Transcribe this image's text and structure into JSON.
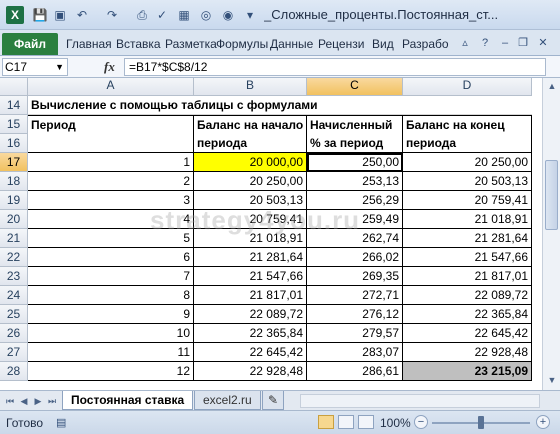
{
  "window": {
    "app_icon": "X",
    "title": "_Сложные_проценты.Постоянная_ст..."
  },
  "quick_access": [
    "save-icon",
    "undo-icon",
    "redo-icon",
    "print-preview-icon",
    "chart-icon",
    "sort-icon"
  ],
  "ribbon": {
    "file_tab": "Файл",
    "tabs": [
      "Главная",
      "Вставка",
      "Разметка",
      "Формулы",
      "Данные",
      "Рецензи",
      "Вид",
      "Разрабо"
    ]
  },
  "formula_bar": {
    "name_box": "C17",
    "fx_label": "fx",
    "formula": "=B17*$C$8/12"
  },
  "columns": [
    "A",
    "B",
    "C",
    "D"
  ],
  "selected_column": "C",
  "selected_row": "17",
  "title_row": {
    "row": "14",
    "text": "Вычисление с помощью таблицы с формулами"
  },
  "header_row": {
    "row_top": "15",
    "row_bottom": "16",
    "a": "Период",
    "b_line1": "Баланс на начало",
    "b_line2": "периода",
    "c_line1": "Начисленный",
    "c_line2": "% за период",
    "d_line1": "Баланс на конец",
    "d_line2": "периода"
  },
  "rows": [
    {
      "row": "17",
      "a": "1",
      "b": "20 000,00",
      "c": "250,00",
      "d": "20 250,00"
    },
    {
      "row": "18",
      "a": "2",
      "b": "20 250,00",
      "c": "253,13",
      "d": "20 503,13"
    },
    {
      "row": "19",
      "a": "3",
      "b": "20 503,13",
      "c": "256,29",
      "d": "20 759,41"
    },
    {
      "row": "20",
      "a": "4",
      "b": "20 759,41",
      "c": "259,49",
      "d": "21 018,91"
    },
    {
      "row": "21",
      "a": "5",
      "b": "21 018,91",
      "c": "262,74",
      "d": "21 281,64"
    },
    {
      "row": "22",
      "a": "6",
      "b": "21 281,64",
      "c": "266,02",
      "d": "21 547,66"
    },
    {
      "row": "23",
      "a": "7",
      "b": "21 547,66",
      "c": "269,35",
      "d": "21 817,01"
    },
    {
      "row": "24",
      "a": "8",
      "b": "21 817,01",
      "c": "272,71",
      "d": "22 089,72"
    },
    {
      "row": "25",
      "a": "9",
      "b": "22 089,72",
      "c": "276,12",
      "d": "22 365,84"
    },
    {
      "row": "26",
      "a": "10",
      "b": "22 365,84",
      "c": "279,57",
      "d": "22 645,42"
    },
    {
      "row": "27",
      "a": "11",
      "b": "22 645,42",
      "c": "283,07",
      "d": "22 928,48"
    },
    {
      "row": "28",
      "a": "12",
      "b": "22 928,48",
      "c": "286,61",
      "d": "23 215,09"
    }
  ],
  "watermark": "strategy4you.ru",
  "colors": {
    "highlight_yellow": "#ffff00",
    "total_gray": "#bfbfbf",
    "file_tab_green": "#2a7f3f"
  },
  "sheet_tabs": {
    "active": "Постоянная ставка",
    "other": "excel2.ru"
  },
  "status": {
    "ready": "Готово",
    "zoom": "100%"
  }
}
